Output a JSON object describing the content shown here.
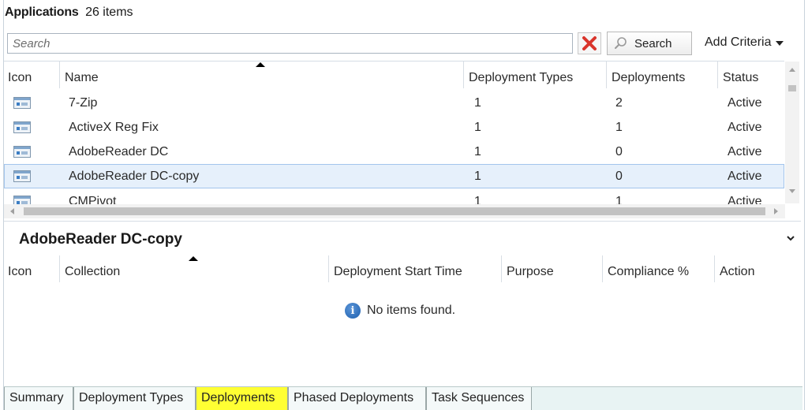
{
  "header": {
    "title": "Applications",
    "count": "26 items"
  },
  "search": {
    "placeholder": "Search",
    "value": "",
    "search_button": "Search",
    "add_criteria": "Add Criteria"
  },
  "main_grid": {
    "columns": [
      "Icon",
      "Name",
      "Deployment Types",
      "Deployments",
      "Status"
    ],
    "rows": [
      {
        "icon": "application-icon",
        "name": "7-Zip",
        "deployment_types": "1",
        "deployments": "2",
        "status": "Active",
        "selected": false
      },
      {
        "icon": "application-icon",
        "name": "ActiveX Reg Fix",
        "deployment_types": "1",
        "deployments": "1",
        "status": "Active",
        "selected": false
      },
      {
        "icon": "application-icon",
        "name": "AdobeReader DC",
        "deployment_types": "1",
        "deployments": "0",
        "status": "Active",
        "selected": false
      },
      {
        "icon": "application-icon",
        "name": "AdobeReader DC-copy",
        "deployment_types": "1",
        "deployments": "0",
        "status": "Active",
        "selected": true
      },
      {
        "icon": "application-icon",
        "name": "CMPivot",
        "deployment_types": "1",
        "deployments": "1",
        "status": "Active",
        "selected": false
      }
    ]
  },
  "detail": {
    "title": "AdobeReader DC-copy",
    "columns": [
      "Icon",
      "Collection",
      "Deployment Start Time",
      "Purpose",
      "Compliance %",
      "Action"
    ],
    "empty_message": "No items found."
  },
  "tabs": [
    {
      "label": "Summary",
      "active": false
    },
    {
      "label": "Deployment Types",
      "active": false
    },
    {
      "label": "Deployments",
      "active": true
    },
    {
      "label": "Phased Deployments",
      "active": false
    },
    {
      "label": "Task Sequences",
      "active": false
    }
  ],
  "colors": {
    "active_tab_highlight": "#ffff33",
    "selected_row": "#e6f0fb",
    "tab_bar": "#e8f3f3",
    "clear_icon": "#d9342b",
    "info_icon": "#1d5fae"
  }
}
